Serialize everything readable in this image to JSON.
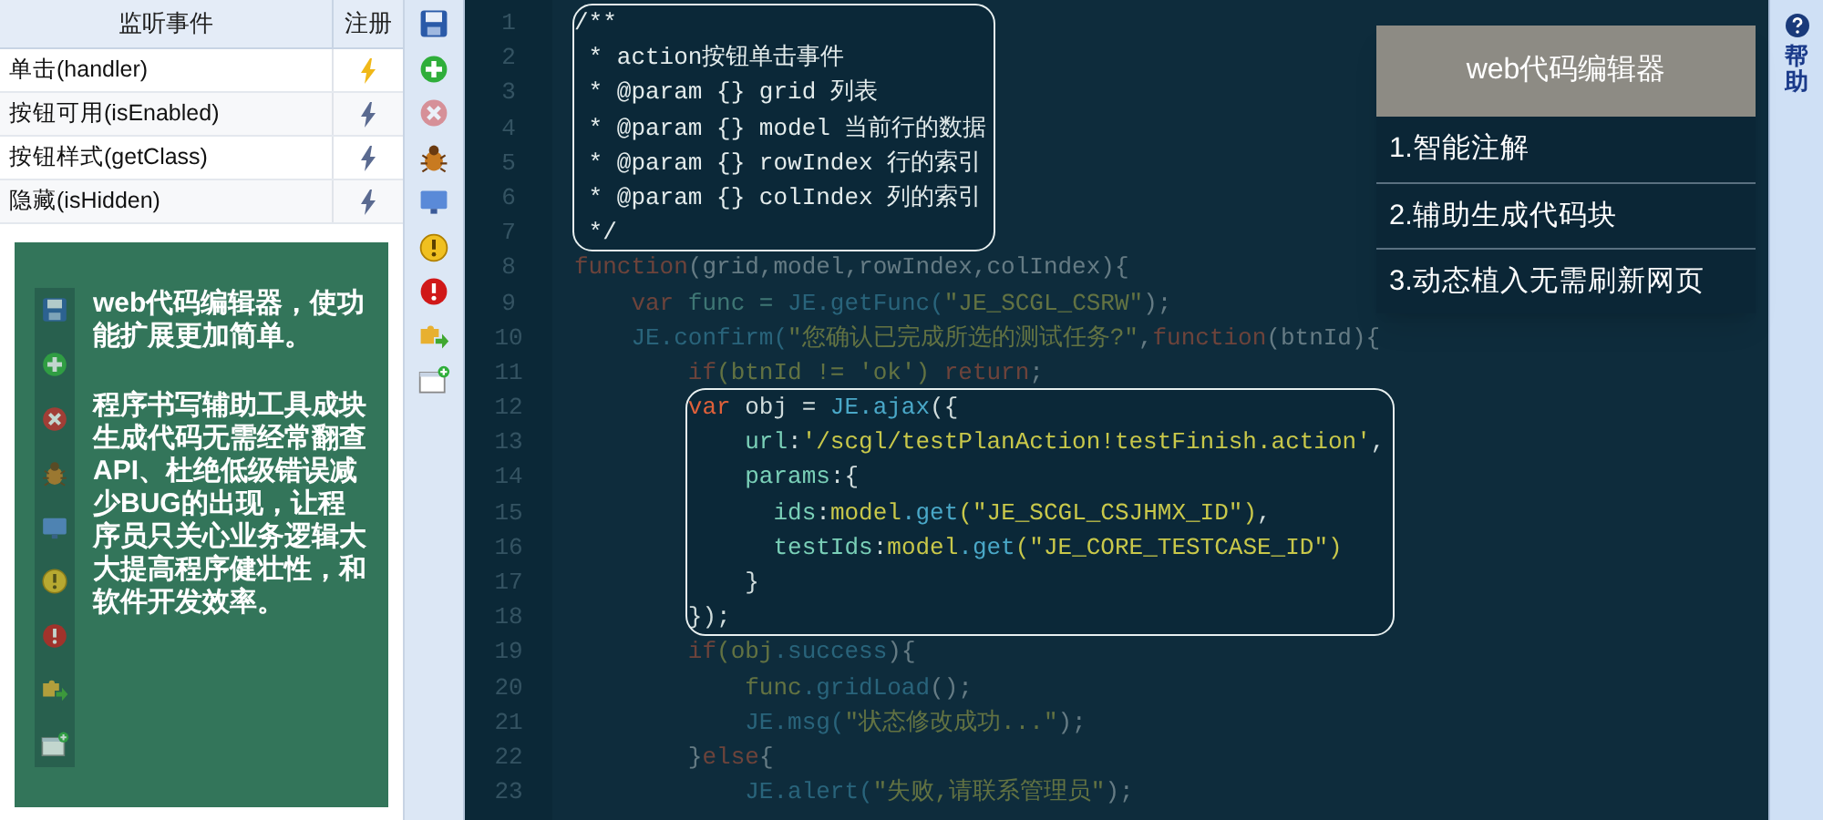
{
  "events_table": {
    "columns": [
      "监听事件",
      "注册"
    ],
    "rows": [
      {
        "name": "单击(handler)",
        "registered": true
      },
      {
        "name": "按钮可用(isEnabled)",
        "registered": false
      },
      {
        "name": "按钮样式(getClass)",
        "registered": false
      },
      {
        "name": "隐藏(isHidden)",
        "registered": false
      }
    ]
  },
  "promo_card": {
    "paragraphs": [
      "web代码编辑器，使功能扩展更加简单。",
      "程序书写辅助工具成块生成代码无需经常翻查API、杜绝低级错误减少BUG的出现，让程序员只关心业务逻辑大大提高程序健壮性，和软件开发效率。"
    ]
  },
  "toolbar": [
    {
      "kind": "save",
      "disabled": false
    },
    {
      "kind": "add",
      "disabled": false
    },
    {
      "kind": "delete",
      "disabled": true
    },
    {
      "kind": "bug",
      "disabled": false
    },
    {
      "kind": "monitor",
      "disabled": false
    },
    {
      "kind": "warning",
      "disabled": false
    },
    {
      "kind": "error",
      "disabled": false
    },
    {
      "kind": "plugin",
      "disabled": false
    },
    {
      "kind": "new_window",
      "disabled": false
    }
  ],
  "editor": {
    "line_numbers": [
      "1",
      "2",
      "3",
      "4",
      "5",
      "6",
      "7",
      "8",
      "9",
      "10",
      "11",
      "12",
      "13",
      "14",
      "15",
      "16",
      "17",
      "18",
      "19",
      "20",
      "21",
      "22",
      "23"
    ],
    "blocks": [
      {
        "highlighted": true,
        "lines": [
          [
            {
              "kind": "comment",
              "text": "/**"
            }
          ],
          [
            {
              "kind": "comment",
              "text": " * action按钮单击事件"
            }
          ],
          [
            {
              "kind": "comment",
              "text": " * @param {} grid 列表"
            }
          ],
          [
            {
              "kind": "comment",
              "text": " * @param {} model 当前行的数据"
            }
          ],
          [
            {
              "kind": "comment",
              "text": " * @param {} rowIndex 行的索引"
            }
          ],
          [
            {
              "kind": "comment",
              "text": " * @param {} colIndex 列的索引"
            }
          ],
          [
            {
              "kind": "comment",
              "text": " */"
            }
          ]
        ]
      },
      {
        "highlighted": false,
        "lines": [
          [
            {
              "kind": "keyword",
              "text": "function"
            },
            {
              "kind": "plain",
              "text": "(grid,model,rowIndex,colIndex){"
            }
          ],
          [
            {
              "kind": "keyword",
              "text": "    var"
            },
            {
              "kind": "prop",
              "text": " func = "
            },
            {
              "kind": "ident",
              "text": "JE.getFunc("
            },
            {
              "kind": "string",
              "text": "\"JE_SCGL_CSRW\""
            },
            {
              "kind": "plain",
              "text": ");"
            }
          ],
          [
            {
              "kind": "ident",
              "text": "    JE.confirm("
            },
            {
              "kind": "string",
              "text": "\"您确认已完成所选的测试任务?\""
            },
            {
              "kind": "plain",
              "text": ","
            },
            {
              "kind": "keyword",
              "text": "function"
            },
            {
              "kind": "plain",
              "text": "(btnId){"
            }
          ],
          [
            {
              "kind": "keyword",
              "text": "        if"
            },
            {
              "kind": "string",
              "text": "(btnId != 'ok') "
            },
            {
              "kind": "keyword",
              "text": "return"
            },
            {
              "kind": "plain",
              "text": ";"
            }
          ]
        ]
      },
      {
        "highlighted": true,
        "lines": [
          [
            {
              "kind": "keyword",
              "text": "        var"
            },
            {
              "kind": "plain",
              "text": " obj = "
            },
            {
              "kind": "ident",
              "text": "JE.ajax"
            },
            {
              "kind": "plain",
              "text": "({"
            }
          ],
          [
            {
              "kind": "prop",
              "text": "            url"
            },
            {
              "kind": "plain",
              "text": ":"
            },
            {
              "kind": "string",
              "text": "'/scgl/testPlanAction!testFinish.action'"
            },
            {
              "kind": "plain",
              "text": ","
            }
          ],
          [
            {
              "kind": "prop",
              "text": "            params"
            },
            {
              "kind": "plain",
              "text": ":{"
            }
          ],
          [
            {
              "kind": "prop",
              "text": "              ids"
            },
            {
              "kind": "plain",
              "text": ":"
            },
            {
              "kind": "string",
              "text": "model"
            },
            {
              "kind": "ident",
              "text": ".get"
            },
            {
              "kind": "string",
              "text": "(\"JE_SCGL_CSJHMX_ID\")"
            },
            {
              "kind": "plain",
              "text": ","
            }
          ],
          [
            {
              "kind": "prop",
              "text": "              testIds"
            },
            {
              "kind": "plain",
              "text": ":"
            },
            {
              "kind": "string",
              "text": "model"
            },
            {
              "kind": "ident",
              "text": ".get"
            },
            {
              "kind": "string",
              "text": "(\"JE_CORE_TESTCASE_ID\")"
            }
          ],
          [
            {
              "kind": "plain",
              "text": "            }"
            }
          ],
          [
            {
              "kind": "plain",
              "text": "        });"
            }
          ]
        ]
      },
      {
        "highlighted": false,
        "lines": [
          [
            {
              "kind": "keyword",
              "text": "        if"
            },
            {
              "kind": "string",
              "text": "(obj"
            },
            {
              "kind": "ident",
              "text": ".success"
            },
            {
              "kind": "plain",
              "text": "){"
            }
          ],
          [
            {
              "kind": "string",
              "text": "            func"
            },
            {
              "kind": "ident",
              "text": ".gridLoad"
            },
            {
              "kind": "plain",
              "text": "();"
            }
          ],
          [
            {
              "kind": "ident",
              "text": "            JE.msg("
            },
            {
              "kind": "string",
              "text": "\"状态修改成功...\""
            },
            {
              "kind": "plain",
              "text": ");"
            }
          ],
          [
            {
              "kind": "plain",
              "text": "        }"
            },
            {
              "kind": "keyword",
              "text": "else"
            },
            {
              "kind": "plain",
              "text": "{"
            }
          ],
          [
            {
              "kind": "ident",
              "text": "            JE.alert("
            },
            {
              "kind": "string",
              "text": "\"失败,请联系管理员\""
            },
            {
              "kind": "plain",
              "text": ");"
            }
          ]
        ]
      }
    ]
  },
  "feature_panel": {
    "title": "web代码编辑器",
    "items": [
      "1.智能注解",
      "2.辅助生成代码块",
      "3.动态植入无需刷新网页"
    ]
  },
  "help_sidebar": {
    "label": "帮助"
  }
}
